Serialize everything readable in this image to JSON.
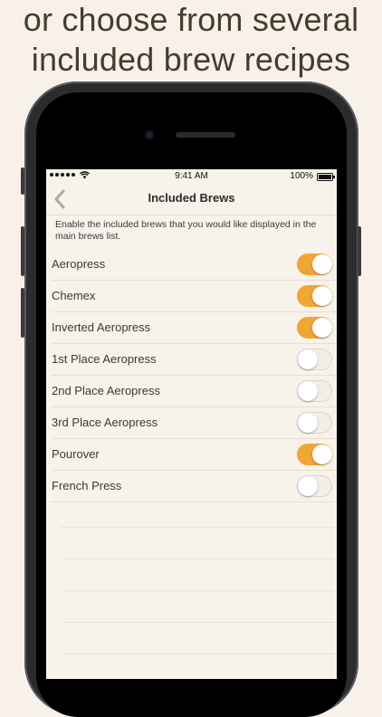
{
  "headline": {
    "line1": "or choose from several",
    "line2": "included brew recipes"
  },
  "status_bar": {
    "time": "9:41 AM",
    "battery": "100%"
  },
  "nav": {
    "title": "Included Brews",
    "back_icon": "chevron-left-icon"
  },
  "description": "Enable the included brews that you would like displayed in the main brews list.",
  "brews": [
    {
      "label": "Aeropress",
      "enabled": true
    },
    {
      "label": "Chemex",
      "enabled": true
    },
    {
      "label": "Inverted Aeropress",
      "enabled": true
    },
    {
      "label": "1st Place Aeropress",
      "enabled": false
    },
    {
      "label": "2nd Place Aeropress",
      "enabled": false
    },
    {
      "label": "3rd Place Aeropress",
      "enabled": false
    },
    {
      "label": "Pourover",
      "enabled": true
    },
    {
      "label": "French Press",
      "enabled": false
    }
  ],
  "colors": {
    "accent": "#f0a636",
    "background": "#f7f2ea",
    "headline": "#4a3a2c"
  }
}
